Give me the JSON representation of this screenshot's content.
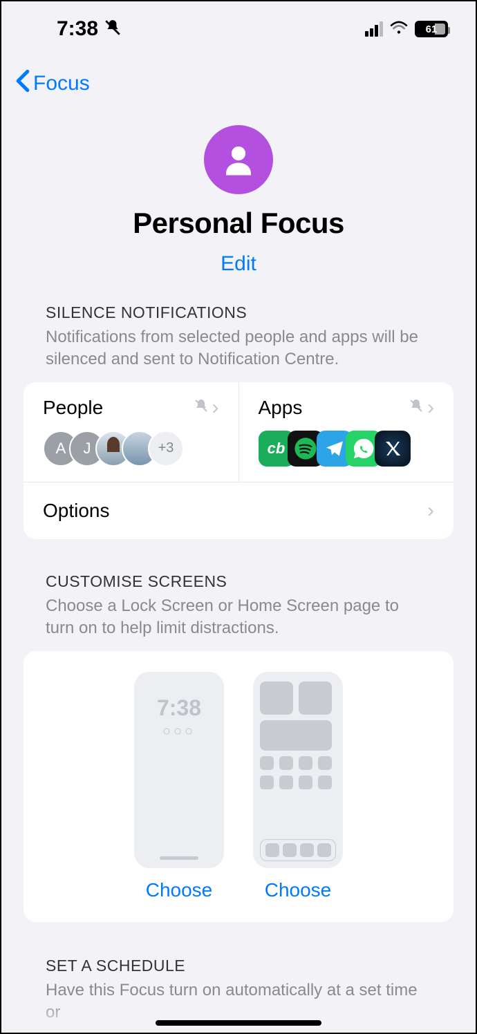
{
  "status": {
    "time": "7:38",
    "battery": "61"
  },
  "nav": {
    "back_label": "Focus"
  },
  "header": {
    "title": "Personal Focus",
    "edit": "Edit"
  },
  "silence": {
    "title": "SILENCE NOTIFICATIONS",
    "subtitle": "Notifications from selected people and apps will be silenced and sent to Notification Centre.",
    "people_label": "People",
    "apps_label": "Apps",
    "people": {
      "initials": [
        "A",
        "J"
      ],
      "more": "+3"
    },
    "options_label": "Options"
  },
  "customise": {
    "title": "CUSTOMISE SCREENS",
    "subtitle": "Choose a Lock Screen or Home Screen page to turn on to help limit distractions.",
    "mock_time": "7:38",
    "choose_lock": "Choose",
    "choose_home": "Choose"
  },
  "schedule": {
    "title": "SET A SCHEDULE",
    "subtitle": "Have this Focus turn on automatically at a set time or"
  }
}
